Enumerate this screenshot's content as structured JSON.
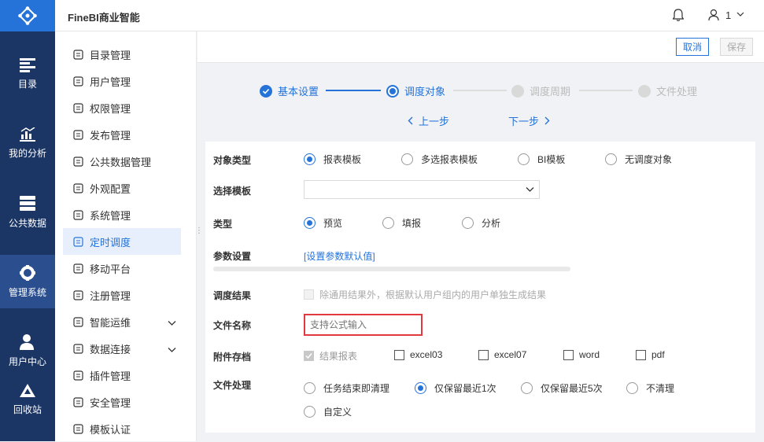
{
  "app": {
    "title": "FineBI商业智能",
    "user": "1"
  },
  "rail": {
    "items": [
      {
        "label": "目录"
      },
      {
        "label": "我的分析"
      },
      {
        "label": "公共数据"
      },
      {
        "label": "管理系统"
      },
      {
        "label": "用户中心"
      },
      {
        "label": "回收站"
      }
    ]
  },
  "sidebar": {
    "items": [
      {
        "label": "目录管理"
      },
      {
        "label": "用户管理"
      },
      {
        "label": "权限管理"
      },
      {
        "label": "发布管理"
      },
      {
        "label": "公共数据管理"
      },
      {
        "label": "外观配置"
      },
      {
        "label": "系统管理"
      },
      {
        "label": "定时调度"
      },
      {
        "label": "移动平台"
      },
      {
        "label": "注册管理"
      },
      {
        "label": "智能运维"
      },
      {
        "label": "数据连接"
      },
      {
        "label": "插件管理"
      },
      {
        "label": "安全管理"
      },
      {
        "label": "模板认证"
      }
    ]
  },
  "toolbar": {
    "cancel": "取消",
    "save": "保存"
  },
  "steps": [
    {
      "label": "基本设置",
      "state": "done"
    },
    {
      "label": "调度对象",
      "state": "current"
    },
    {
      "label": "调度周期",
      "state": "pending"
    },
    {
      "label": "文件处理",
      "state": "pending"
    }
  ],
  "nav": {
    "prev": "上一步",
    "next": "下一步"
  },
  "form": {
    "object_type": {
      "label": "对象类型",
      "options": [
        "报表模板",
        "多选报表模板",
        "BI模板",
        "无调度对象"
      ],
      "selected": "报表模板"
    },
    "select_template": {
      "label": "选择模板",
      "value": ""
    },
    "type": {
      "label": "类型",
      "options": [
        "预览",
        "填报",
        "分析"
      ],
      "selected": "预览"
    },
    "params": {
      "label": "参数设置",
      "link": "[设置参数默认值]"
    },
    "result": {
      "label": "调度结果",
      "checkbox": "除通用结果外，根据默认用户组内的用户单独生成结果"
    },
    "filename": {
      "label": "文件名称",
      "placeholder": "支持公式输入"
    },
    "attach": {
      "label": "附件存档",
      "options": [
        "结果报表",
        "excel03",
        "excel07",
        "word",
        "pdf"
      ]
    },
    "file_process": {
      "label": "文件处理",
      "options": [
        "任务结束即清理",
        "仅保留最近1次",
        "仅保留最近5次",
        "不清理",
        "自定义"
      ],
      "selected": "仅保留最近1次"
    }
  },
  "colors": {
    "accent": "#2573d9",
    "rail": "#1b3564",
    "error_border": "#e0393e"
  }
}
